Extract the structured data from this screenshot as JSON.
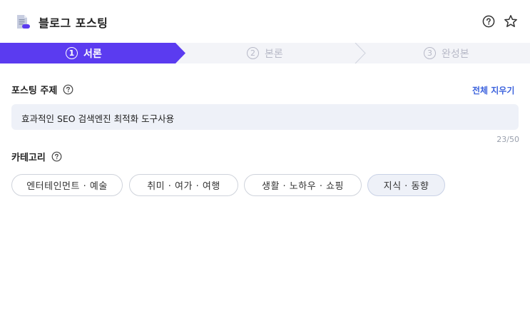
{
  "header": {
    "title": "블로그 포스팅",
    "doc_icon": "document-icon",
    "help_icon": "question-circle-icon",
    "star_icon": "star-outline-icon"
  },
  "stepper": {
    "steps": [
      {
        "number": "1",
        "label": "서론",
        "active": true
      },
      {
        "number": "2",
        "label": "본론",
        "active": false
      },
      {
        "number": "3",
        "label": "완성본",
        "active": false
      }
    ]
  },
  "topic": {
    "label": "포스팅 주제",
    "clear_label": "전체 지우기",
    "value": "효과적인 SEO 검색엔진 최적화 도구사용",
    "counter": "23/50"
  },
  "category": {
    "label": "카테고리",
    "chips": [
      {
        "label": "엔터테인먼트 · 예술",
        "selected": false
      },
      {
        "label": "취미 · 여가 · 여행",
        "selected": false
      },
      {
        "label": "생활 · 노하우 · 쇼핑",
        "selected": false
      },
      {
        "label": "지식 · 동향",
        "selected": true
      }
    ]
  },
  "colors": {
    "accent": "#5b3bf0",
    "link": "#3d63dd",
    "input_bg": "#eef1f8",
    "step_inactive": "#b7b9c7"
  }
}
